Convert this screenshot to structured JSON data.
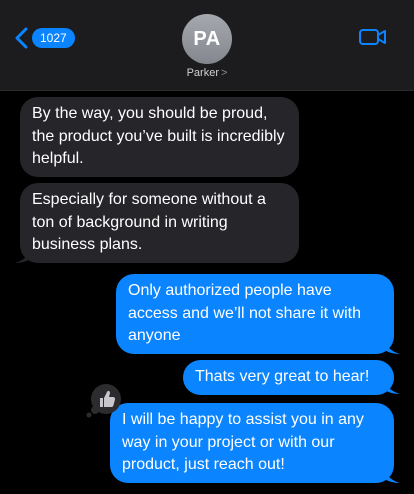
{
  "header": {
    "back_badge": "1027",
    "avatar_initials": "PA",
    "contact_name": "Parker",
    "name_chevron": ">"
  },
  "messages": [
    {
      "direction": "incoming",
      "text": "By the way, you should be proud, the product you’ve built is incredibly helpful."
    },
    {
      "direction": "incoming",
      "text": "Especially for someone without a ton of background in writing business plans."
    },
    {
      "direction": "outgoing",
      "text": "Only authorized people have access and we’ll not share it with anyone"
    },
    {
      "direction": "outgoing",
      "text": "Thats very great to hear!"
    },
    {
      "direction": "outgoing",
      "text": "I will be happy to assist you in any way in your project or with our product, just reach out!"
    }
  ],
  "tapback": {
    "icon": "thumbs-up-icon"
  },
  "colors": {
    "header_bg": "#1c1c1e",
    "accent": "#0a84ff",
    "incoming_bubble": "#26252a",
    "outgoing_bubble": "#0a84ff",
    "background": "#000000"
  }
}
